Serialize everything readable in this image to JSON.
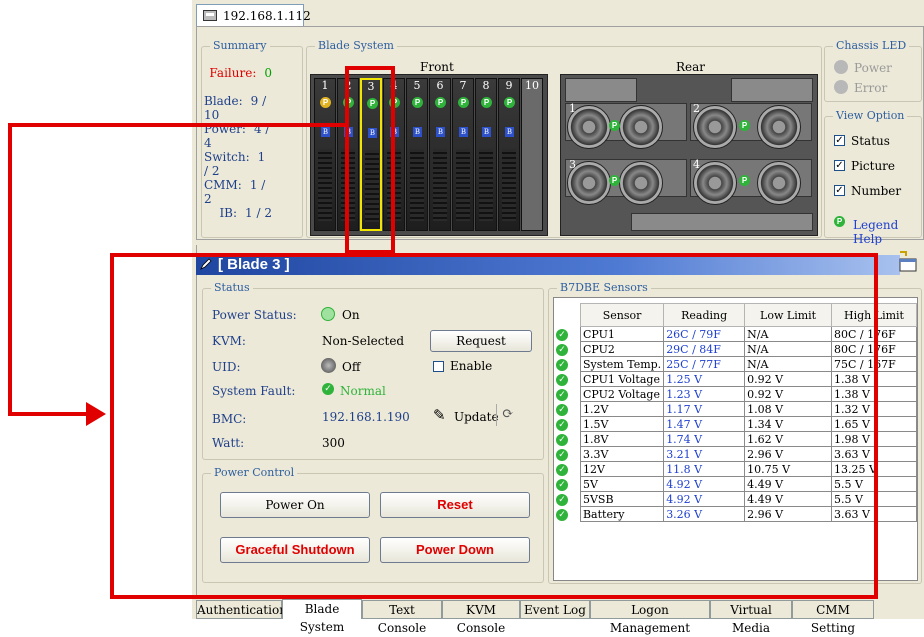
{
  "window_tab": {
    "title": "192.168.1.112"
  },
  "summary": {
    "title": "Summary",
    "rows": [
      {
        "label": "Failure:",
        "value": "0"
      },
      {
        "label": "Blade:",
        "value": "9 / 10"
      },
      {
        "label": "Power:",
        "value": "4 / 4"
      },
      {
        "label": "Switch:",
        "value": "1 / 2"
      },
      {
        "label": "CMM:",
        "value": "1 / 2"
      },
      {
        "label": "IB:",
        "value": "1 / 2"
      }
    ],
    "colors": {
      "failure_label": "#e00000",
      "failure_value": "#00a000"
    }
  },
  "blade_system": {
    "title": "Blade System",
    "front_label": "Front",
    "rear_label": "Rear",
    "front_slots": [
      "1",
      "2",
      "3",
      "4",
      "5",
      "6",
      "7",
      "8",
      "9",
      "10"
    ],
    "rear_modules": [
      "1",
      "2",
      "3",
      "4"
    ],
    "selected_slot": "3"
  },
  "chassis_led": {
    "title": "Chassis LED",
    "items": [
      "Power",
      "Error"
    ]
  },
  "view_option": {
    "title": "View Option",
    "items": [
      "Status",
      "Picture",
      "Number"
    ],
    "legend_help": "Legend Help"
  },
  "blade": {
    "header": "[ Blade 3 ]",
    "status": {
      "title": "Status",
      "power_status_label": "Power Status:",
      "power_status_value": "On",
      "kvm_label": "KVM:",
      "kvm_value": "Non-Selected",
      "request_button": "Request",
      "uid_label": "UID:",
      "uid_value": "Off",
      "enable_label": "Enable",
      "system_fault_label": "System Fault:",
      "system_fault_value": "Normal",
      "bmc_label": "BMC:",
      "bmc_value": "192.168.1.190",
      "update_label": "Update",
      "watt_label": "Watt:",
      "watt_value": "300"
    },
    "power_control": {
      "title": "Power Control",
      "power_on": "Power On",
      "reset": "Reset",
      "graceful_shutdown": "Graceful Shutdown",
      "power_down": "Power Down"
    }
  },
  "sensors": {
    "title": "B7DBE Sensors",
    "columns": [
      "Sensor",
      "Reading",
      "Low Limit",
      "High Limit"
    ],
    "rows": [
      [
        "CPU1",
        "26C / 79F",
        "N/A",
        "80C / 176F"
      ],
      [
        "CPU2",
        "29C / 84F",
        "N/A",
        "80C / 176F"
      ],
      [
        "System Temp.",
        "25C / 77F",
        "N/A",
        "75C / 167F"
      ],
      [
        "CPU1 Voltage",
        "1.25 V",
        "0.92 V",
        "1.38 V"
      ],
      [
        "CPU2 Voltage",
        "1.23 V",
        "0.92 V",
        "1.38 V"
      ],
      [
        "1.2V",
        "1.17 V",
        "1.08 V",
        "1.32 V"
      ],
      [
        "1.5V",
        "1.47 V",
        "1.34 V",
        "1.65 V"
      ],
      [
        "1.8V",
        "1.74 V",
        "1.62 V",
        "1.98 V"
      ],
      [
        "3.3V",
        "3.21 V",
        "2.96 V",
        "3.63 V"
      ],
      [
        "12V",
        "11.8 V",
        "10.75 V",
        "13.25 V"
      ],
      [
        "5V",
        "4.92 V",
        "4.49 V",
        "5.5 V"
      ],
      [
        "5VSB",
        "4.92 V",
        "4.49 V",
        "5.5 V"
      ],
      [
        "Battery",
        "3.26 V",
        "2.96 V",
        "3.63 V"
      ]
    ]
  },
  "tabs": [
    "Authentication",
    "Blade System",
    "Text Console",
    "KVM Console",
    "Event Log",
    "Logon Management",
    "Virtual Media",
    "CMM Setting"
  ],
  "active_tab": "Blade System",
  "colors": {
    "annotation": "#e00000",
    "header_blue": "#1f46a0",
    "value_blue": "#1e3fd0"
  }
}
